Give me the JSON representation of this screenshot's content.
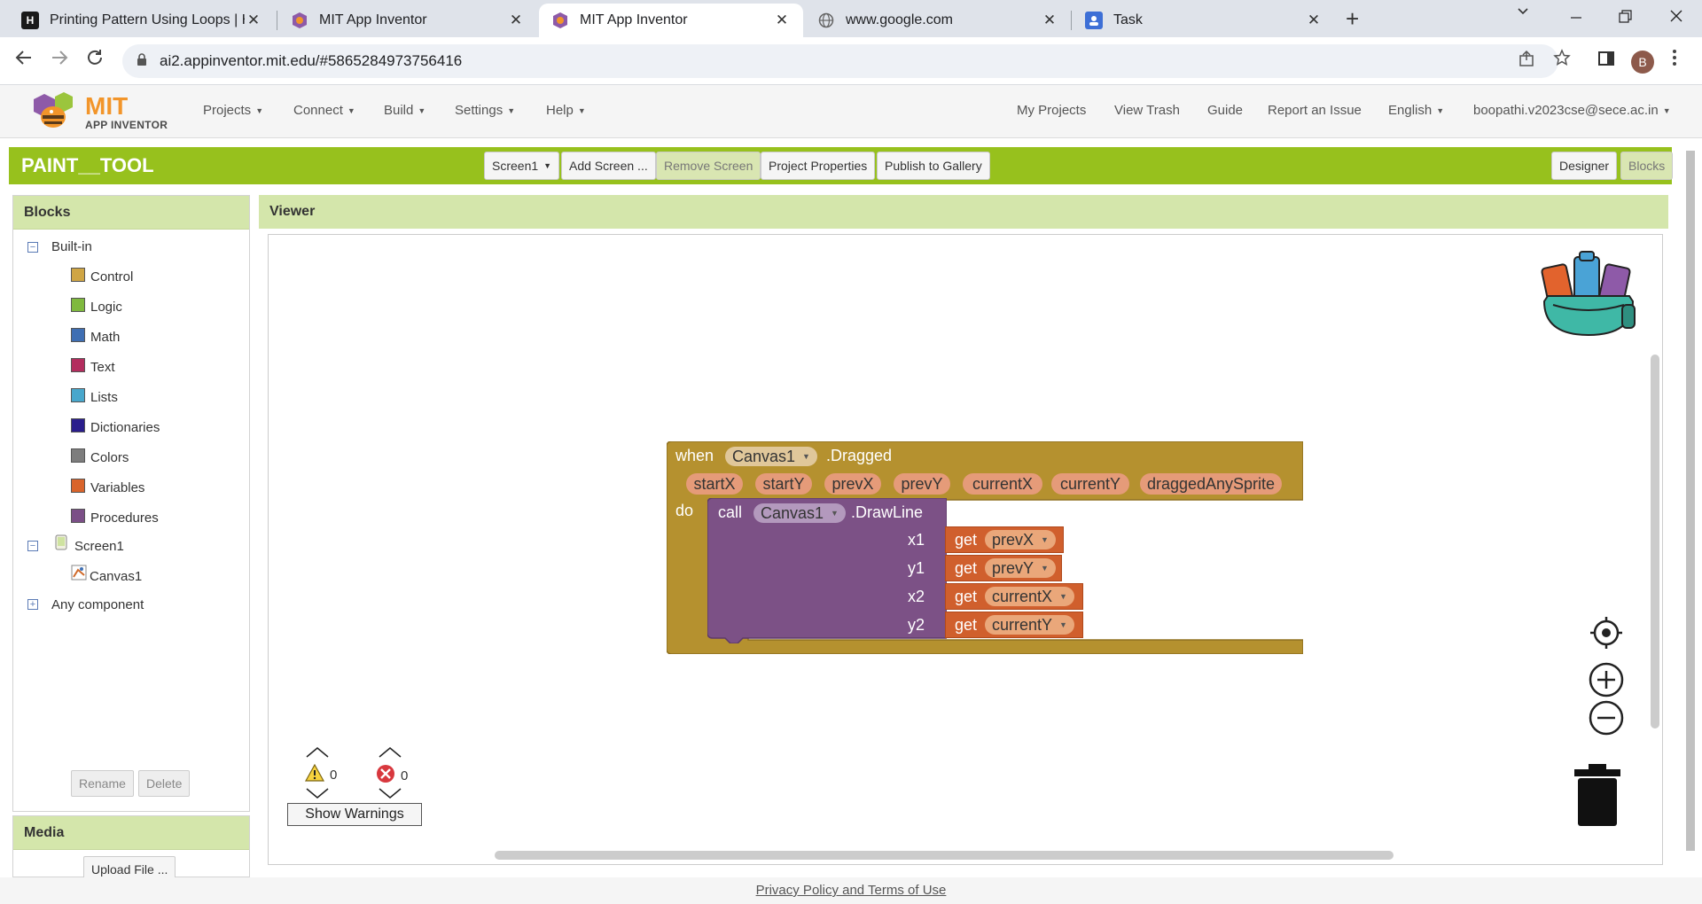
{
  "browser": {
    "tabs": [
      {
        "title": "Printing Pattern Using Loops | H",
        "close": "✕"
      },
      {
        "title": "MIT App Inventor",
        "close": "✕"
      },
      {
        "title": "MIT App Inventor",
        "close": "✕"
      },
      {
        "title": "www.google.com",
        "close": "✕"
      },
      {
        "title": "Task",
        "close": "✕"
      }
    ],
    "url": "ai2.appinventor.mit.edu/#5865284973756416",
    "profile_initial": "B"
  },
  "app": {
    "logo_mit": "MIT",
    "logo_sub": "APP INVENTOR",
    "menus": [
      "Projects",
      "Connect",
      "Build",
      "Settings",
      "Help"
    ],
    "right_links": [
      "My Projects",
      "View Trash",
      "Guide",
      "Report an Issue"
    ],
    "language": "English",
    "user": "boopathi.v2023cse@sece.ac.in"
  },
  "project": {
    "name": "PAINT__TOOL",
    "screen_select": "Screen1",
    "add_screen": "Add Screen ...",
    "remove_screen": "Remove Screen",
    "properties": "Project Properties",
    "publish": "Publish to Gallery",
    "designer": "Designer",
    "blocks": "Blocks"
  },
  "blocks_panel": {
    "title": "Blocks",
    "builtin": "Built-in",
    "categories": [
      {
        "label": "Control",
        "color": "#cfa544"
      },
      {
        "label": "Logic",
        "color": "#7fb93e"
      },
      {
        "label": "Math",
        "color": "#3f6fb3"
      },
      {
        "label": "Text",
        "color": "#b32d5e"
      },
      {
        "label": "Lists",
        "color": "#48a7cc"
      },
      {
        "label": "Dictionaries",
        "color": "#2a1d8c"
      },
      {
        "label": "Colors",
        "color": "#7d7d7d"
      },
      {
        "label": "Variables",
        "color": "#d9642b"
      },
      {
        "label": "Procedures",
        "color": "#7b4f87"
      }
    ],
    "screen": "Screen1",
    "component": "Canvas1",
    "any_component": "Any component",
    "rename": "Rename",
    "delete": "Delete"
  },
  "media": {
    "title": "Media",
    "upload": "Upload File ..."
  },
  "viewer": {
    "title": "Viewer",
    "event": {
      "when": "when",
      "component": "Canvas1",
      "event_name": ".Dragged",
      "params": [
        "startX",
        "startY",
        "prevX",
        "prevY",
        "currentX",
        "currentY",
        "draggedAnySprite"
      ],
      "do": "do"
    },
    "call": {
      "call": "call",
      "component": "Canvas1",
      "method": ".DrawLine",
      "args": [
        {
          "name": "x1",
          "get": "get",
          "var": "prevX"
        },
        {
          "name": "y1",
          "get": "get",
          "var": "prevY"
        },
        {
          "name": "x2",
          "get": "get",
          "var": "currentX"
        },
        {
          "name": "y2",
          "get": "get",
          "var": "currentY"
        }
      ]
    },
    "warnings_count": "0",
    "errors_count": "0",
    "show_warnings": "Show Warnings"
  },
  "footer": "Privacy Policy and Terms of Use"
}
